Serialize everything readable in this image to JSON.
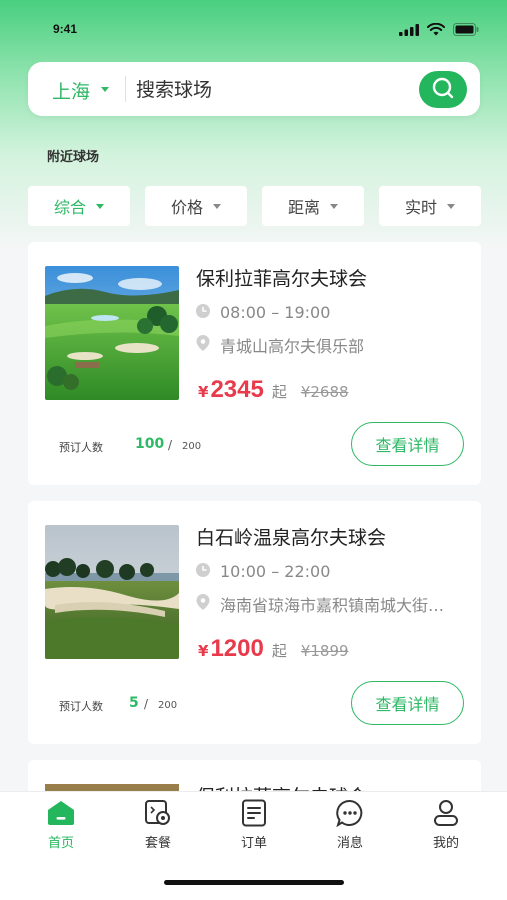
{
  "status_bar": {
    "time": "9:41"
  },
  "search": {
    "city": "上海",
    "placeholder": "搜索球场"
  },
  "section_title": "附近球场",
  "filters": [
    {
      "label": "综合",
      "active": true
    },
    {
      "label": "价格",
      "active": false
    },
    {
      "label": "距离",
      "active": false
    },
    {
      "label": "实时",
      "active": false
    }
  ],
  "courses": [
    {
      "name": "保利拉菲高尔夫球会",
      "hours": "08:00 – 19:00",
      "address": "青城山高尔夫俱乐部",
      "currency": "¥",
      "price": "2345",
      "price_suffix": "起",
      "original_price": "¥2688",
      "booked_label": "预订人数",
      "booked": "100",
      "slash": "/",
      "capacity": "200",
      "detail_label": "查看详情"
    },
    {
      "name": "白石岭温泉高尔夫球会",
      "hours": "10:00 – 22:00",
      "address": "海南省琼海市嘉积镇南城大街…",
      "currency": "¥",
      "price": "1200",
      "price_suffix": "起",
      "original_price": "¥1899",
      "booked_label": "预订人数",
      "booked": "5",
      "slash": "/",
      "capacity": "200",
      "detail_label": "查看详情"
    },
    {
      "name": "保利拉菲高尔夫球会"
    }
  ],
  "tabbar": [
    {
      "label": "首页",
      "icon": "home-icon",
      "active": true
    },
    {
      "label": "套餐",
      "icon": "package-icon",
      "active": false
    },
    {
      "label": "订单",
      "icon": "order-icon",
      "active": false
    },
    {
      "label": "消息",
      "icon": "message-icon",
      "active": false
    },
    {
      "label": "我的",
      "icon": "profile-icon",
      "active": false
    }
  ],
  "colors": {
    "accent": "#23b65c",
    "price": "#e93a4c"
  }
}
